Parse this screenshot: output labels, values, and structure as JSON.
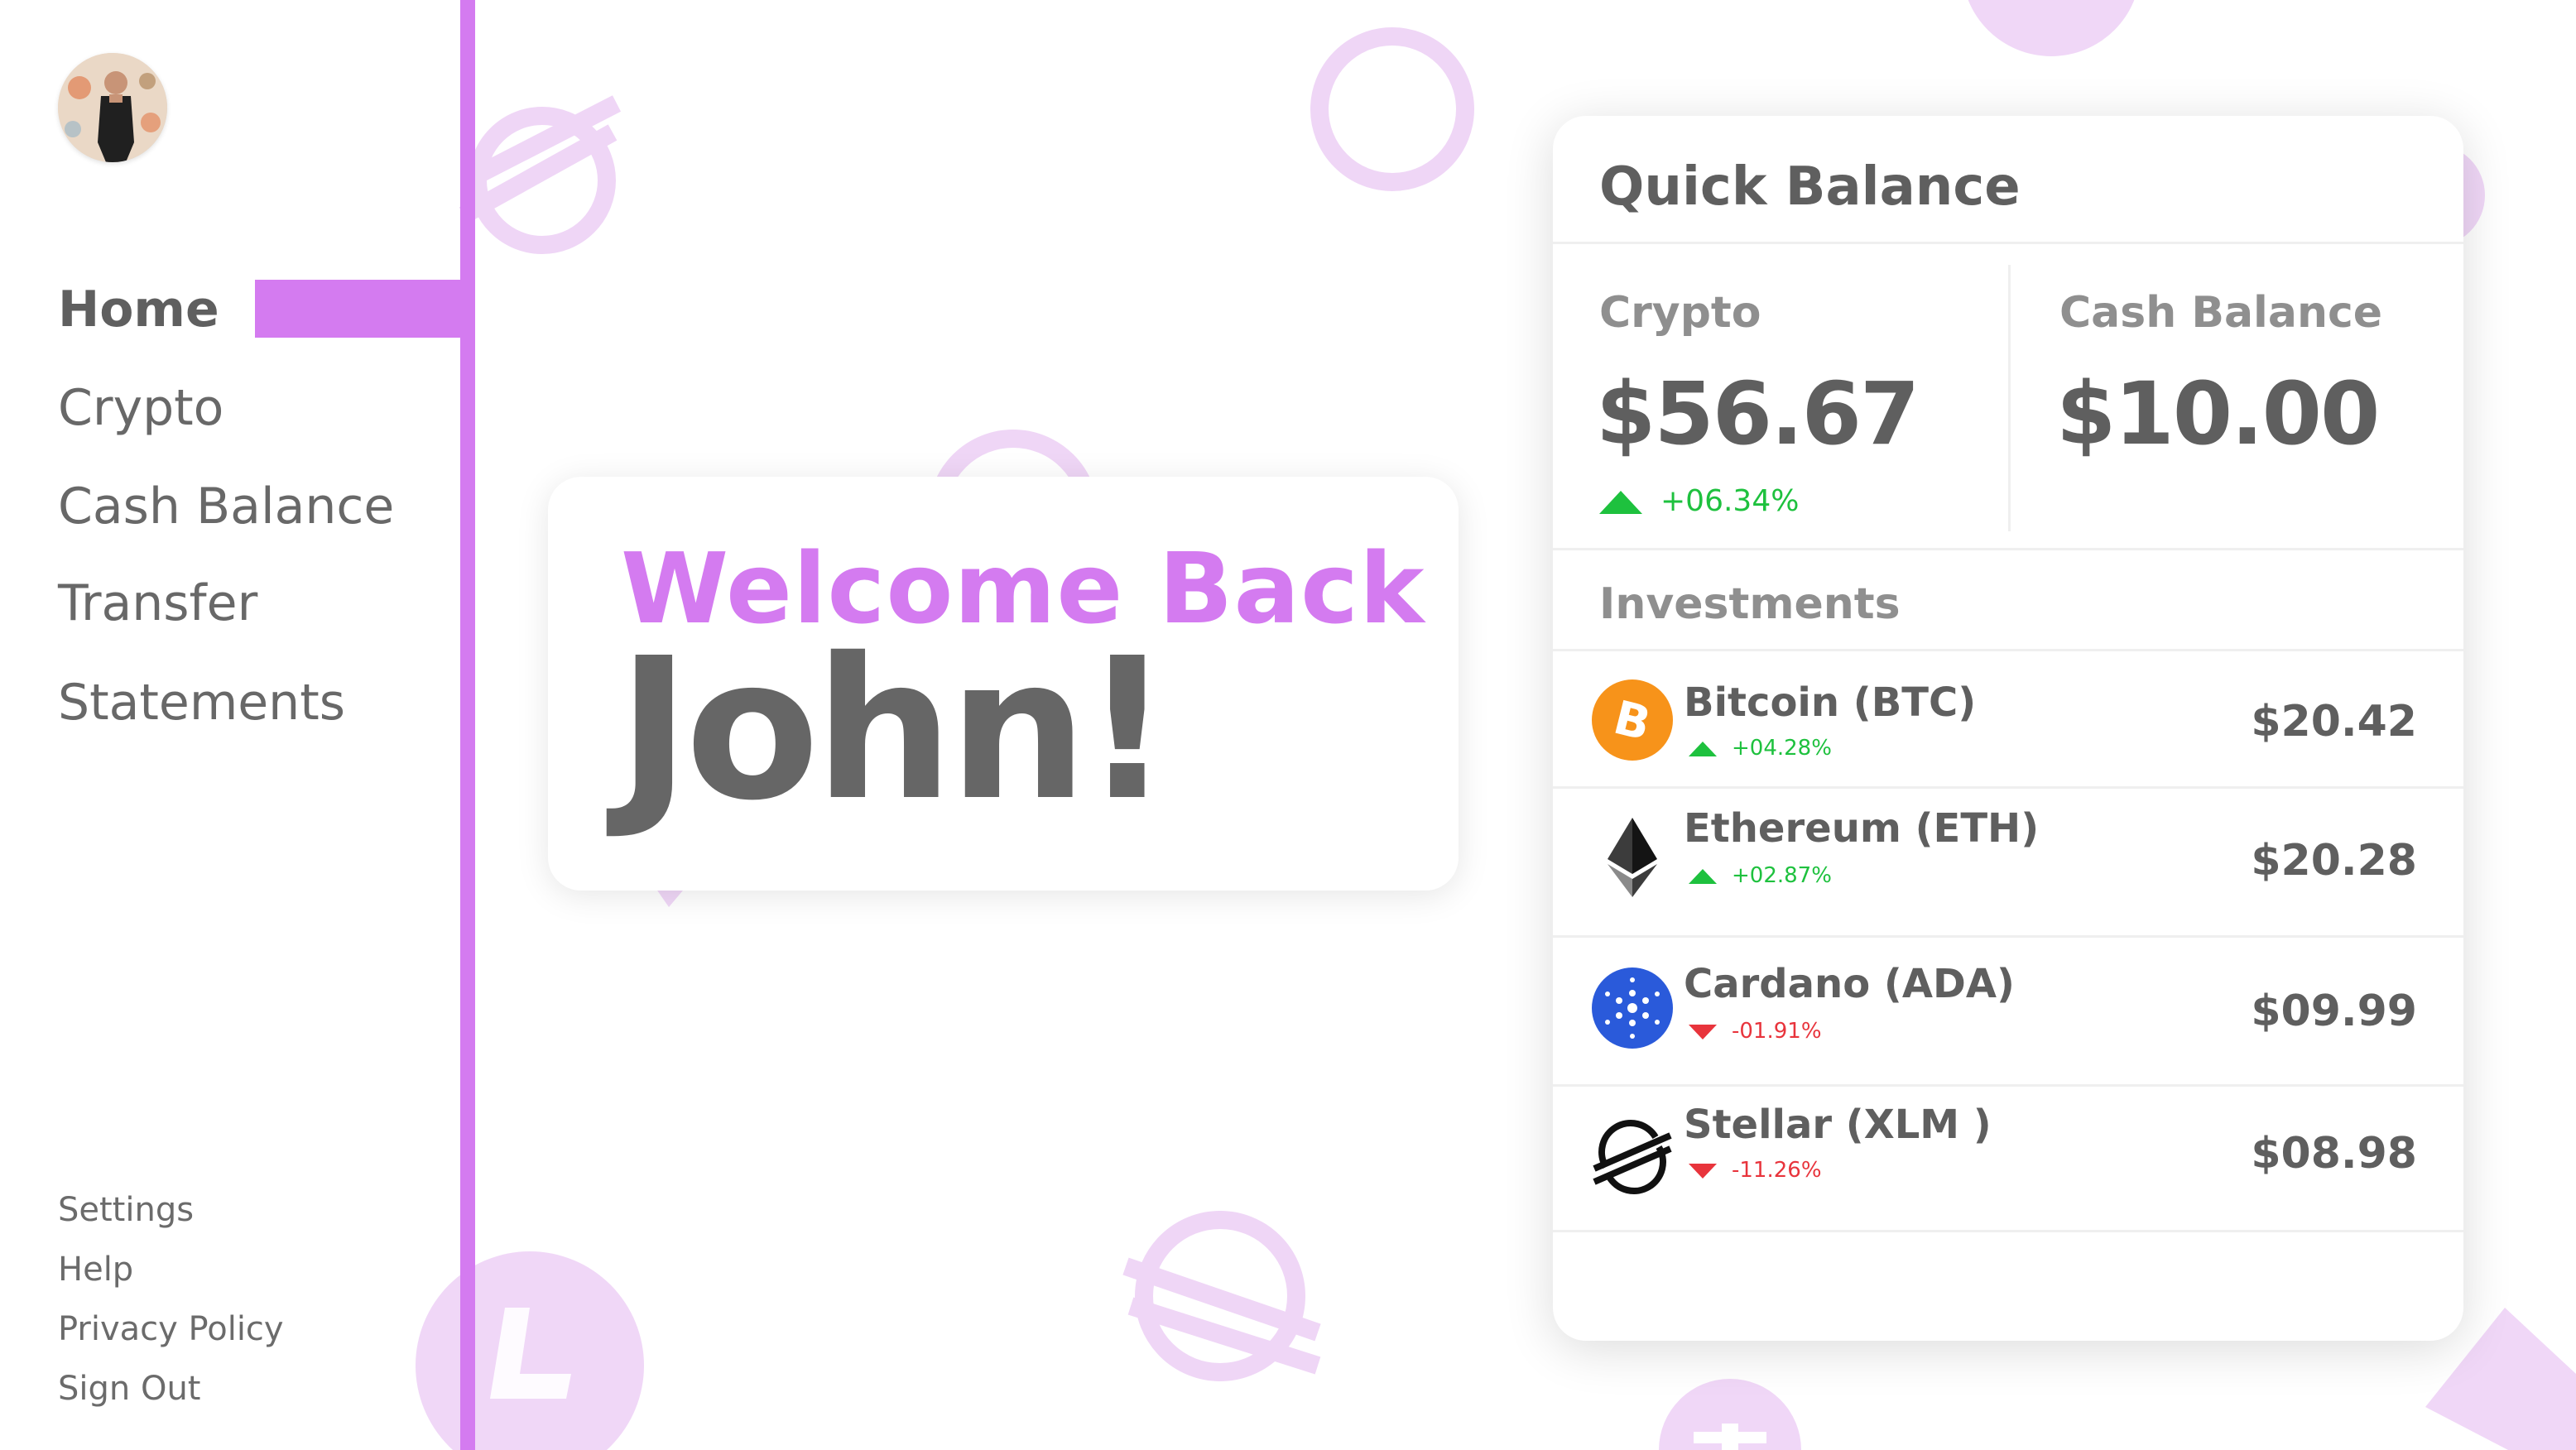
{
  "colors": {
    "accent": "#d47bf0",
    "text": "#5f5f5f",
    "muted": "#8f8f8f",
    "positive": "#1ec13e",
    "negative": "#e8343c",
    "btc": "#f7931a",
    "ada": "#2a5ada"
  },
  "sidebar": {
    "avatar_icon": "user-avatar",
    "nav": [
      {
        "label": "Home",
        "active": true
      },
      {
        "label": "Crypto",
        "active": false
      },
      {
        "label": "Cash Balance",
        "active": false
      },
      {
        "label": "Transfer",
        "active": false
      },
      {
        "label": "Statements",
        "active": false
      }
    ],
    "footer": [
      "Settings",
      "Help",
      "Privacy Policy",
      "Sign Out"
    ]
  },
  "welcome": {
    "line1": "Welcome Back",
    "line2": "John!"
  },
  "quick_balance": {
    "title": "Quick Balance",
    "crypto": {
      "label": "Crypto",
      "value": "$56.67",
      "change": "+06.34%",
      "direction": "up"
    },
    "cash": {
      "label": "Cash Balance",
      "value": "$10.00"
    },
    "investments_label": "Investments",
    "investments": [
      {
        "name": "Bitcoin (BTC)",
        "change": "+04.28%",
        "direction": "up",
        "value": "$20.42",
        "icon": "bitcoin-icon"
      },
      {
        "name": "Ethereum (ETH)",
        "change": "+02.87%",
        "direction": "up",
        "value": "$20.28",
        "icon": "ethereum-icon"
      },
      {
        "name": "Cardano (ADA)",
        "change": "-01.91%",
        "direction": "down",
        "value": "$09.99",
        "icon": "cardano-icon"
      },
      {
        "name": "Stellar (XLM )",
        "change": "-11.26%",
        "direction": "down",
        "value": "$08.98",
        "icon": "stellar-icon"
      }
    ]
  }
}
